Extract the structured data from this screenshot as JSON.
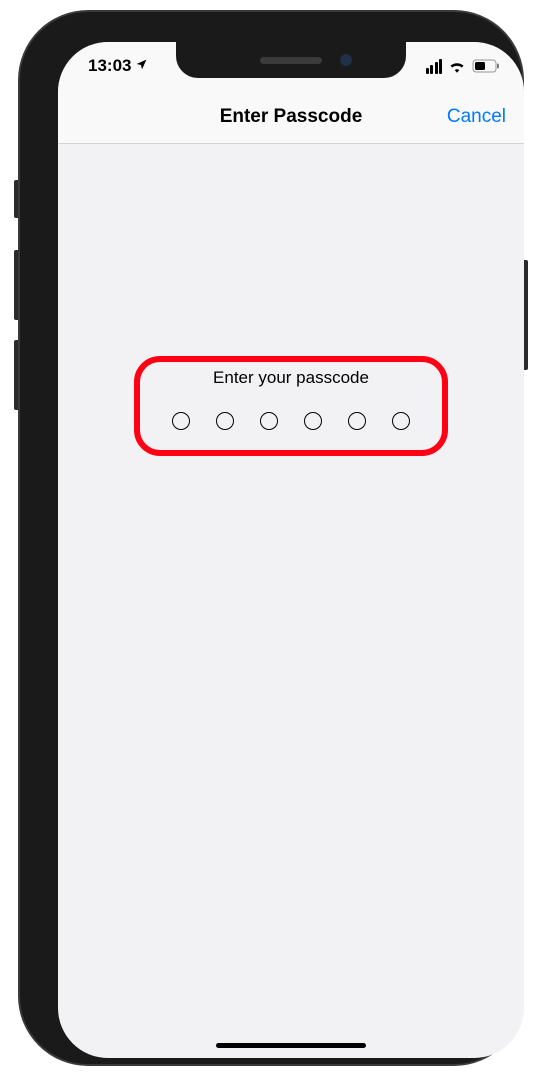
{
  "status_bar": {
    "time": "13:03",
    "location_icon": "location-arrow-icon",
    "signal_icon": "cellular-signal-icon",
    "wifi_icon": "wifi-icon",
    "battery_icon": "battery-icon"
  },
  "nav": {
    "title": "Enter Passcode",
    "cancel_label": "Cancel"
  },
  "passcode": {
    "prompt": "Enter your passcode",
    "digits": 6
  },
  "colors": {
    "ios_blue": "#007aff",
    "highlight_red": "#ff0015",
    "background": "#f2f2f5"
  }
}
